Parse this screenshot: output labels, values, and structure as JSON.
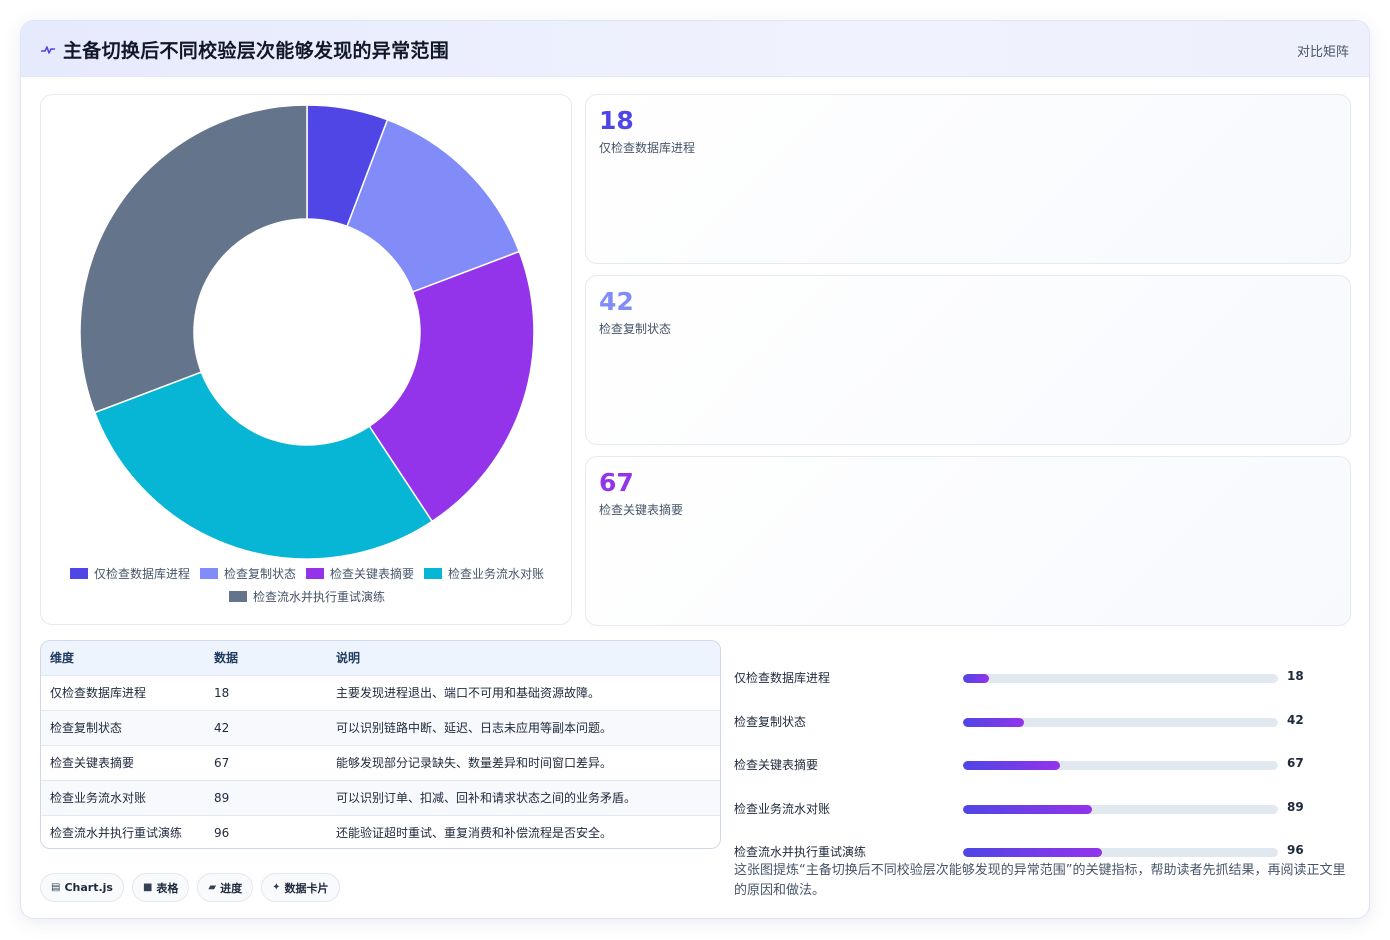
{
  "header": {
    "title": "主备切换后不同校验层次能够发现的异常范围",
    "badge": "对比矩阵",
    "icon": "pulse-icon"
  },
  "colors": {
    "accent": "#4f46e5",
    "series": [
      "#4f46e5",
      "#818cf8",
      "#9333ea",
      "#06b6d4",
      "#64748b"
    ]
  },
  "chart_data": {
    "type": "pie",
    "variant": "doughnut",
    "title": "",
    "labels": [
      "仅检查数据库进程",
      "检查复制状态",
      "检查关键表摘要",
      "检查业务流水对账",
      "检查流水并执行重试演练"
    ],
    "values": [
      18,
      42,
      67,
      89,
      96
    ],
    "colors": [
      "#4f46e5",
      "#818cf8",
      "#9333ea",
      "#06b6d4",
      "#64748b"
    ],
    "legend": "bottom"
  },
  "stats": [
    {
      "value": "18",
      "label": "仅检查数据库进程",
      "color": "#4f46e5"
    },
    {
      "value": "42",
      "label": "检查复制状态",
      "color": "#818cf8"
    },
    {
      "value": "67",
      "label": "检查关键表摘要",
      "color": "#9333ea"
    }
  ],
  "table": {
    "headers": [
      "维度",
      "数据",
      "说明"
    ],
    "rows": [
      [
        "仅检查数据库进程",
        "18",
        "主要发现进程退出、端口不可用和基础资源故障。"
      ],
      [
        "检查复制状态",
        "42",
        "可以识别链路中断、延迟、日志未应用等副本问题。"
      ],
      [
        "检查关键表摘要",
        "67",
        "能够发现部分记录缺失、数量差异和时间窗口差异。"
      ],
      [
        "检查业务流水对账",
        "89",
        "可以识别订单、扣减、回补和请求状态之间的业务矛盾。"
      ],
      [
        "检查流水并执行重试演练",
        "96",
        "还能验证超时重试、重复消费和补偿流程是否安全。"
      ]
    ]
  },
  "progress": {
    "max": 218,
    "items": [
      {
        "label": "仅检查数据库进程",
        "value": 18
      },
      {
        "label": "检查复制状态",
        "value": 42
      },
      {
        "label": "检查关键表摘要",
        "value": 67
      },
      {
        "label": "检查业务流水对账",
        "value": 89
      },
      {
        "label": "检查流水并执行重试演练",
        "value": 96
      }
    ]
  },
  "chips": [
    {
      "icon": "chart-icon",
      "glyph": "▤",
      "label": "Chart.js"
    },
    {
      "icon": "table-icon",
      "glyph": "■",
      "label": "表格"
    },
    {
      "icon": "progress-icon",
      "glyph": "▰",
      "label": "进度"
    },
    {
      "icon": "sparkle-icon",
      "glyph": "✦",
      "label": "数据卡片"
    }
  ],
  "note": "这张图提炼“主备切换后不同校验层次能够发现的异常范围”的关键指标，帮助读者先抓结果，再阅读正文里的原因和做法。"
}
